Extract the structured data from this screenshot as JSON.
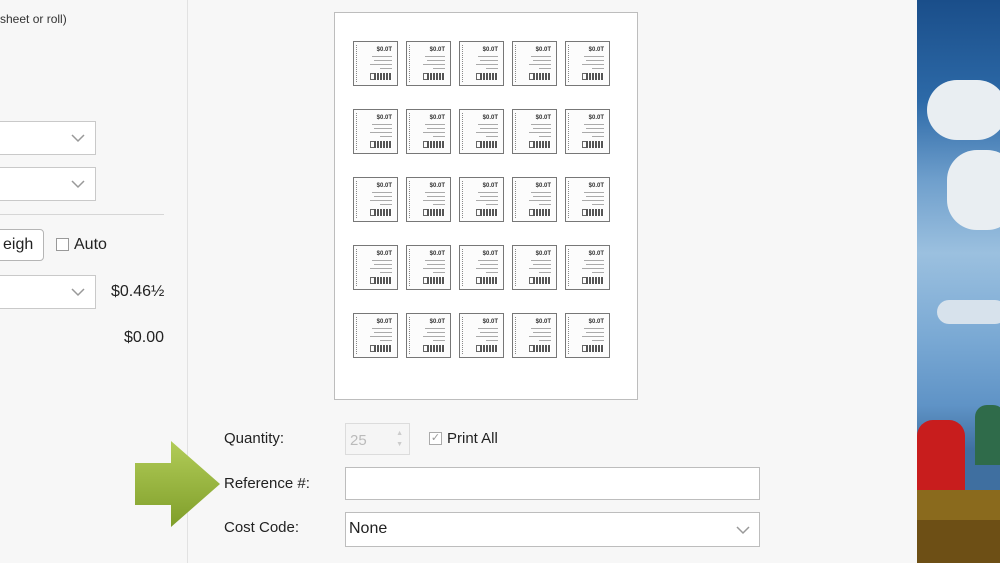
{
  "left_panel": {
    "hint": "sheet or roll)",
    "weigh_button": "eigh",
    "auto_label": "Auto",
    "postage_price": "$0.46½",
    "total_price": "$0.00"
  },
  "sheet": {
    "rows": 5,
    "columns": 5,
    "stamp_price": "$0.0T"
  },
  "form": {
    "quantity_label": "Quantity:",
    "quantity_value": "25",
    "print_all_label": "Print All",
    "print_all_checked": true,
    "reference_label": "Reference #:",
    "reference_value": "",
    "cost_code_label": "Cost Code:",
    "cost_code_value": "None"
  },
  "icons": {
    "chevron": "chevron-down-icon",
    "arrow": "green-arrow-icon",
    "checkbox": "checkbox-icon"
  },
  "colors": {
    "arrow": "#95b43a",
    "panel_bg": "#f7f7f7"
  }
}
